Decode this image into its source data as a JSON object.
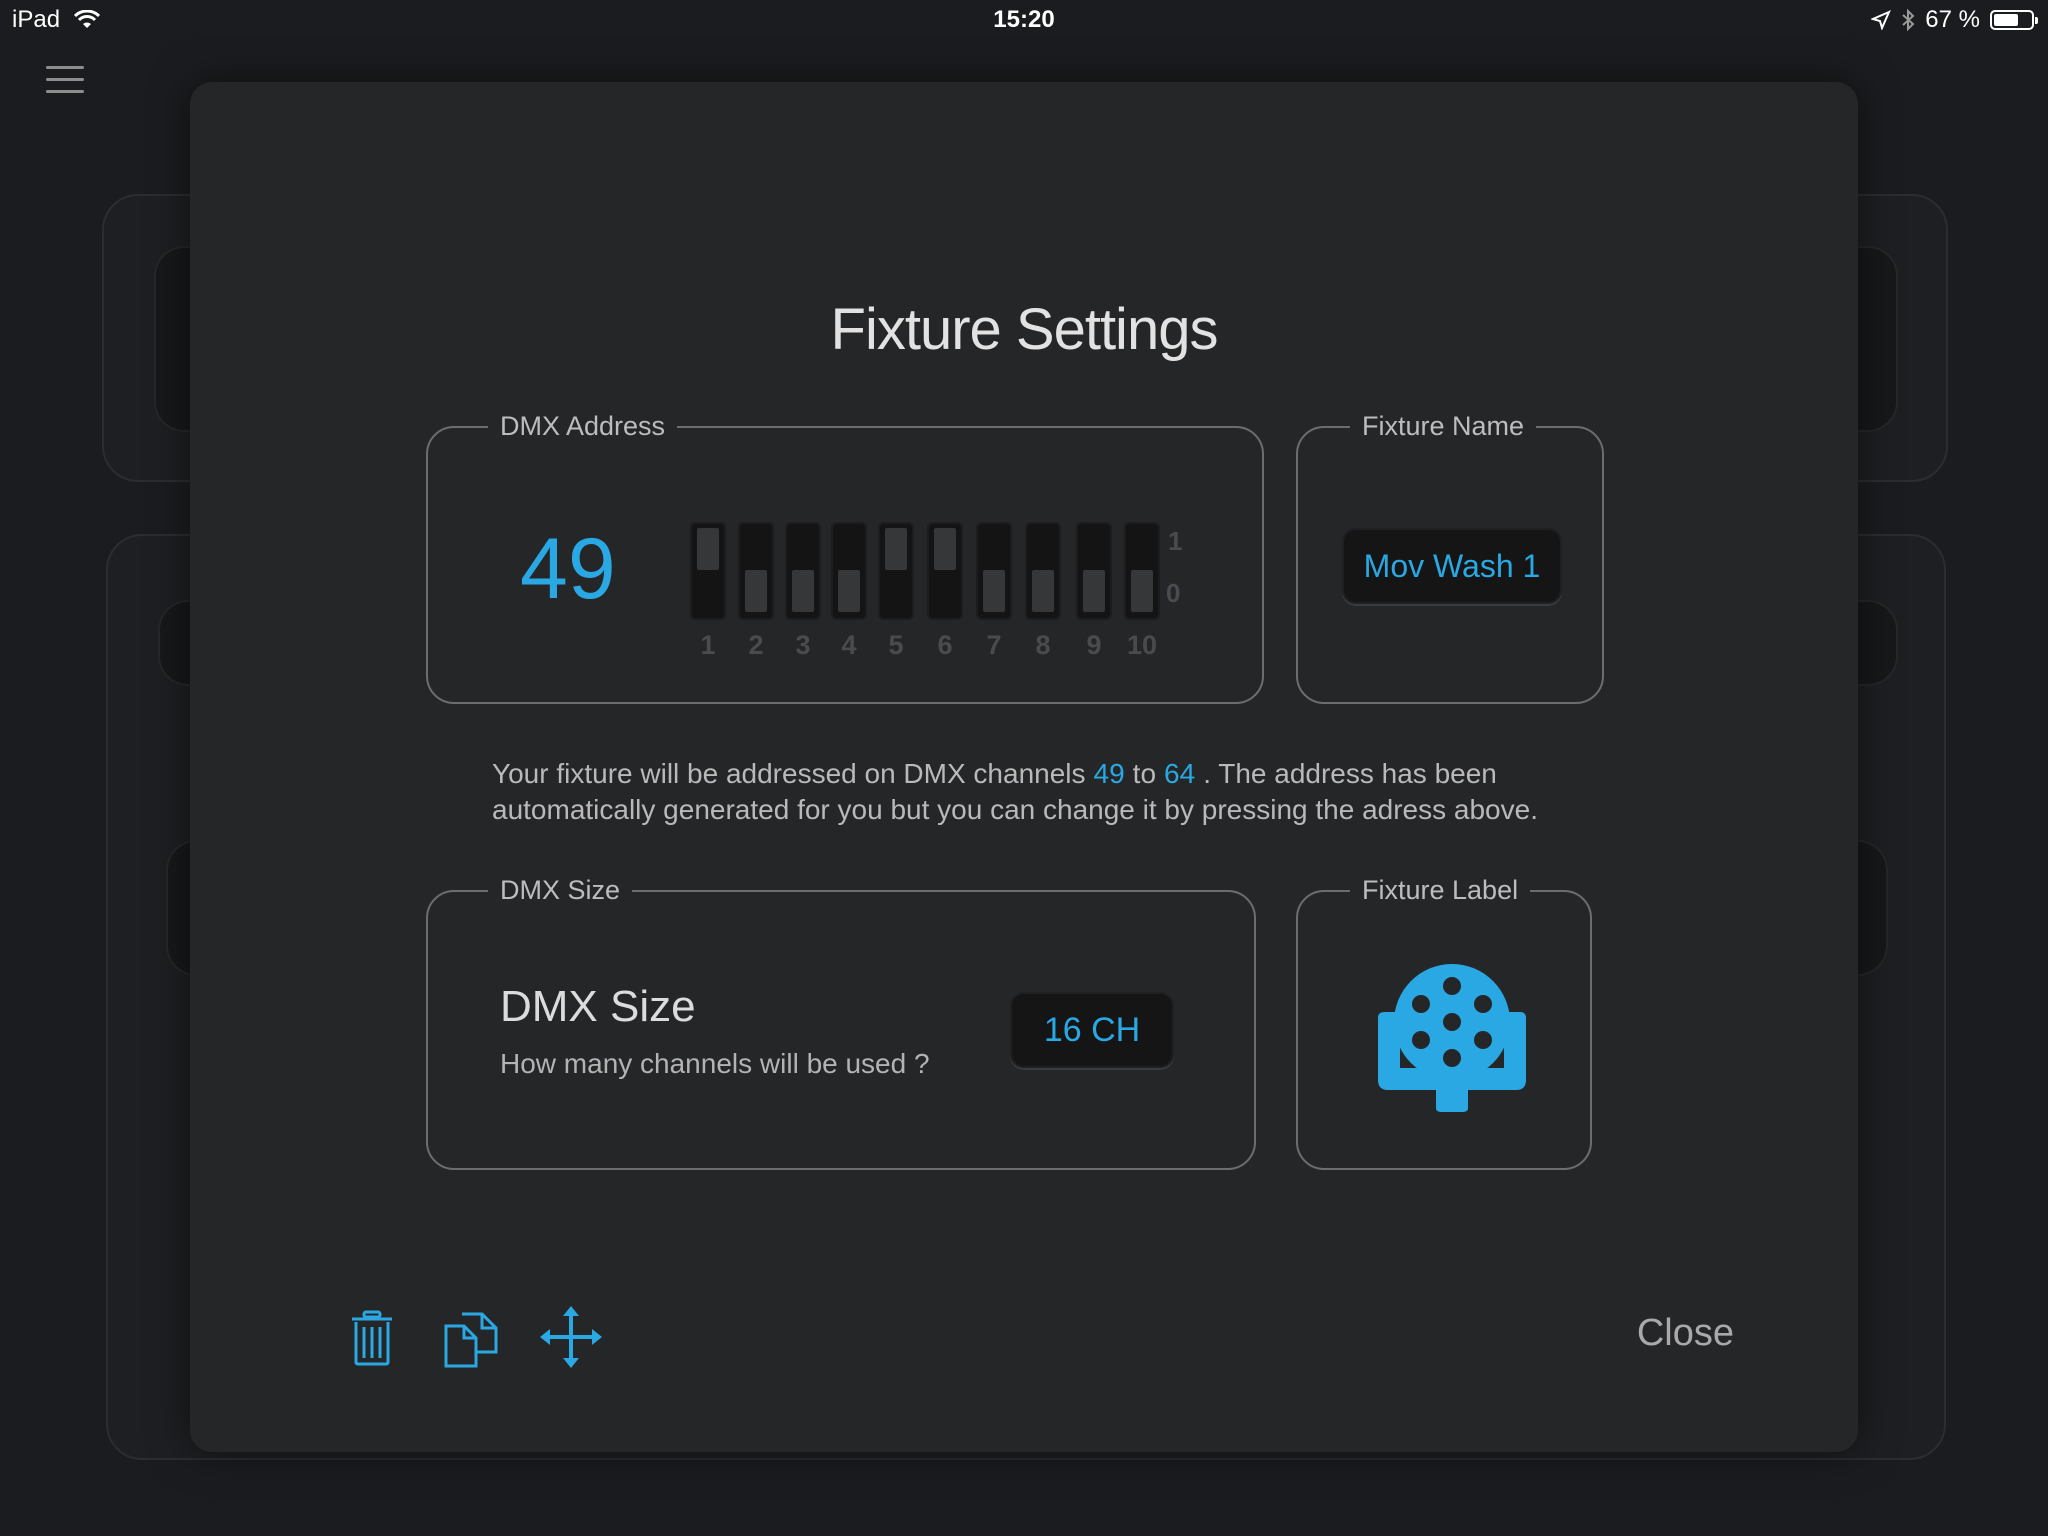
{
  "status_bar": {
    "device": "iPad",
    "time": "15:20",
    "battery": "67 %",
    "battery_level": 0.67,
    "icons": [
      "wifi-icon",
      "location-icon",
      "bluetooth-icon",
      "battery-icon"
    ]
  },
  "modal": {
    "title": "Fixture Settings",
    "dmx_address": {
      "legend": "DMX Address",
      "value": "49",
      "dip_labels": [
        "1",
        "2",
        "3",
        "4",
        "5",
        "6",
        "7",
        "8",
        "9",
        "10"
      ],
      "dip_states": [
        1,
        0,
        0,
        0,
        1,
        1,
        0,
        0,
        0,
        0
      ],
      "scale_on": "1",
      "scale_off": "0"
    },
    "fixture_name": {
      "legend": "Fixture Name",
      "value": "Mov Wash 1"
    },
    "info": {
      "part1": "Your fixture will be addressed on DMX channels",
      "from": "49",
      "to_word": "to",
      "to": "64",
      "part2": ". The address has been automatically generated for you but you can change it by pressing the adress above."
    },
    "dmx_size": {
      "legend": "DMX Size",
      "title": "DMX Size",
      "subtitle": "How many channels will be used ?",
      "value": "16 CH"
    },
    "fixture_label": {
      "legend": "Fixture Label",
      "icon": "moving-head-wash-icon"
    },
    "toolbar": {
      "icons": [
        "trash-icon",
        "duplicate-icon",
        "move-icon"
      ]
    },
    "close_label": "Close"
  },
  "colors": {
    "accent": "#2aa8e3",
    "modal_bg": "#252628",
    "page_bg": "#1b1c1f"
  }
}
